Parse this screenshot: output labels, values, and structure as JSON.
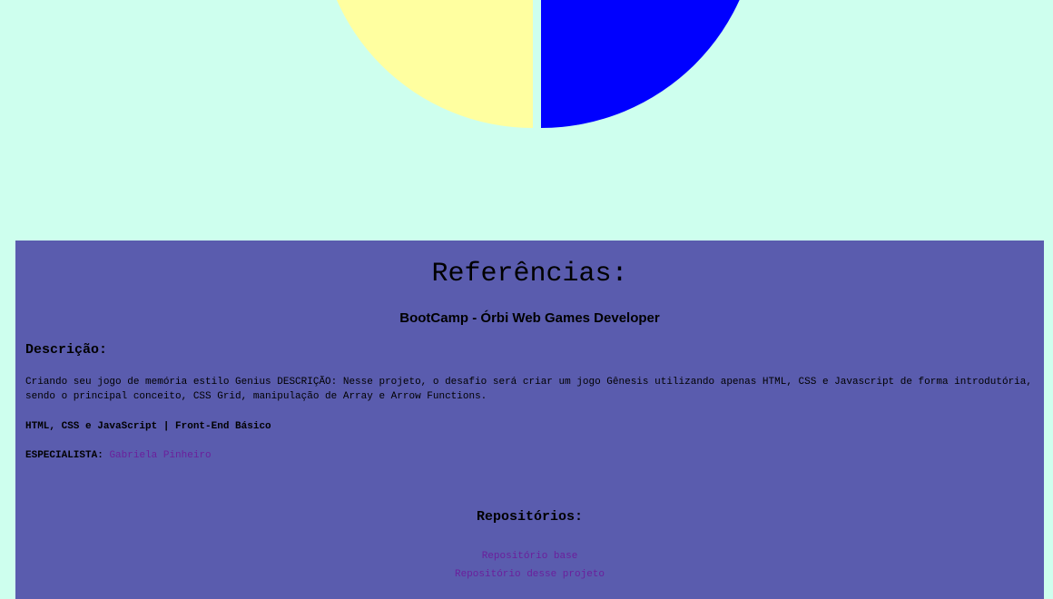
{
  "game": {
    "colors": {
      "yellow": "#ffffa0",
      "blue": "#0000ff"
    }
  },
  "footer": {
    "background": "#5a5cae",
    "title": "Referências:",
    "bootcamp": "BootCamp - Órbi Web Games Developer",
    "description_title": "Descrição:",
    "description_text": "Criando seu jogo de memória estilo Genius DESCRIÇÃO: Nesse projeto, o desafio será criar um jogo Gênesis utilizando apenas HTML, CSS e Javascript de forma introdutória, sendo o principal conceito, CSS Grid, manipulação de Array e Arrow Functions.",
    "tech": "HTML, CSS e JavaScript | Front-End Básico",
    "specialist_label": "ESPECIALISTA:",
    "specialist_name": "Gabriela Pinheiro",
    "repos_title": "Repositórios:",
    "repos": [
      "Repositório base",
      "Repositório desse projeto"
    ]
  }
}
